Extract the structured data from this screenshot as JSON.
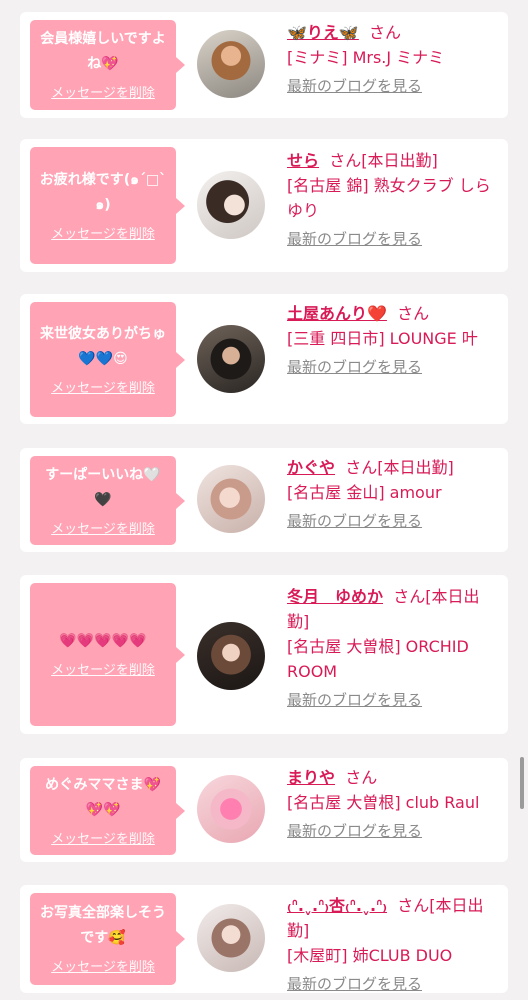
{
  "delete_label": "メッセージを削除",
  "blog_label": "最新のブログを見る",
  "san_label": "さん",
  "colors": {
    "bubble": "#ffa3b5",
    "link": "#d81b57",
    "muted": "#8a8a8a"
  },
  "messages": [
    {
      "text": "会員様嬉しいですよね💖",
      "name": "🦋りえ🦋",
      "status": "",
      "shop": "[ミナミ] Mrs.J ミナミ"
    },
    {
      "text": "お疲れ様です(๑´□`๑)",
      "name": "せら",
      "status": "[本日出勤]",
      "shop": "[名古屋 錦] 熟女クラブ しらゆり"
    },
    {
      "text": "来世彼女ありがちゅ💙💙😍",
      "name": "土屋あんり❤️",
      "status": "",
      "shop": "[三重 四日市] LOUNGE 叶"
    },
    {
      "text": "すーぱーいいね🤍🖤",
      "name": "かぐや",
      "status": "[本日出勤]",
      "shop": "[名古屋 金山] amour"
    },
    {
      "text": "💗💗💗💗💗",
      "name": "冬月　ゆめか",
      "status": "[本日出勤]",
      "shop": "[名古屋 大曽根] ORCHID ROOM"
    },
    {
      "text": "めぐみママさま💖💖💖",
      "name": "まりや",
      "status": "",
      "shop": "[名古屋 大曽根] club Raul"
    },
    {
      "text": "お写真全部楽しそうです🥰",
      "name": "₍ᐢ.ˬ.ᐢ₎杏₍ᐢ.ˬ.ᐢ₎",
      "status": "[本日出勤]",
      "shop": "[木屋町] 姉CLUB DUO"
    }
  ]
}
